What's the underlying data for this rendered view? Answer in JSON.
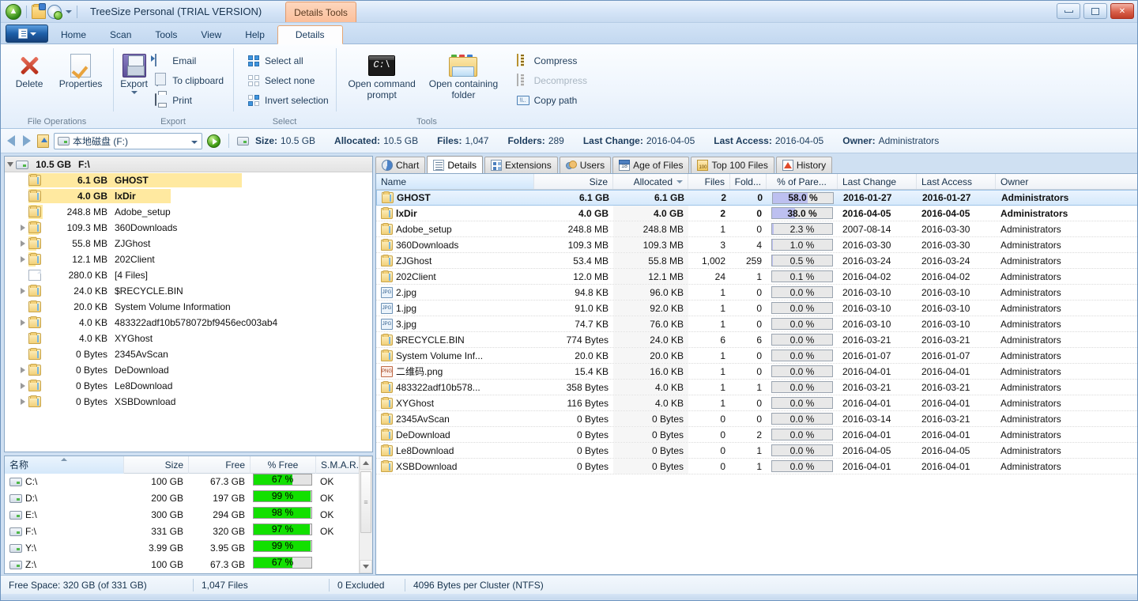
{
  "window": {
    "app_title": "TreeSize Personal  (TRIAL VERSION)",
    "context_tab_label": "Details Tools",
    "minimize": "Minimize",
    "maximize": "Maximize",
    "close": "Close"
  },
  "ribbon": {
    "tabs": [
      {
        "label": "Home",
        "active": false
      },
      {
        "label": "Scan",
        "active": false
      },
      {
        "label": "Tools",
        "active": false
      },
      {
        "label": "View",
        "active": false
      },
      {
        "label": "Help",
        "active": false
      },
      {
        "label": "Details",
        "active": true
      }
    ],
    "groups": [
      {
        "title": "File Operations",
        "big": [
          {
            "label": "Delete",
            "icon": "delete-icon"
          },
          {
            "label": "Properties",
            "icon": "properties-icon"
          }
        ],
        "small": []
      },
      {
        "title": "Export",
        "big": [
          {
            "label": "Export",
            "icon": "export-save-icon",
            "has_caret": true
          }
        ],
        "small": [
          {
            "label": "Email",
            "icon": "email-icon",
            "disabled": false
          },
          {
            "label": "To clipboard",
            "icon": "clipboard-icon",
            "disabled": false
          },
          {
            "label": "Print",
            "icon": "printer-icon",
            "disabled": false
          }
        ]
      },
      {
        "title": "Select",
        "big": [],
        "small": [
          {
            "label": "Select all",
            "icon": "select-all-icon",
            "disabled": false
          },
          {
            "label": "Select none",
            "icon": "select-none-icon",
            "disabled": false
          },
          {
            "label": "Invert selection",
            "icon": "invert-selection-icon",
            "disabled": false
          }
        ]
      },
      {
        "title": "Tools",
        "big": [
          {
            "label": "Open command prompt",
            "icon": "command-prompt-icon"
          },
          {
            "label": "Open containing folder",
            "icon": "folder-open-icon"
          }
        ],
        "small": [
          {
            "label": "Compress",
            "icon": "compress-icon",
            "disabled": false
          },
          {
            "label": "Decompress",
            "icon": "decompress-icon",
            "disabled": true
          },
          {
            "label": "Copy path",
            "icon": "copy-path-icon",
            "disabled": false
          }
        ]
      }
    ]
  },
  "address_bar": {
    "path_value": "本地磁盘 (F:)",
    "back": "Back",
    "forward": "Forward",
    "up": "Up one level",
    "go": "Go",
    "info": [
      {
        "label": "Size:",
        "value": "10.5 GB"
      },
      {
        "label": "Allocated:",
        "value": "10.5 GB"
      },
      {
        "label": "Files:",
        "value": "1,047"
      },
      {
        "label": "Folders:",
        "value": "289"
      },
      {
        "label": "Last Change:",
        "value": "2016-04-05"
      },
      {
        "label": "Last Access:",
        "value": "2016-04-05"
      },
      {
        "label": "Owner:",
        "value": "Administrators"
      }
    ]
  },
  "tree": {
    "root": {
      "size": "10.5 GB",
      "name": "F:\\",
      "icon": "drive-icon",
      "expanded": true
    },
    "rows": [
      {
        "size": "6.1 GB",
        "name": "GHOST",
        "icon": "folder-icon",
        "expandable": false,
        "bar_pct": 100,
        "highlight": true
      },
      {
        "size": "4.0 GB",
        "name": "lxDir",
        "icon": "folder-icon",
        "expandable": false,
        "bar_pct": 65.6,
        "highlight": true
      },
      {
        "size": "248.8 MB",
        "name": "Adobe_setup",
        "icon": "folder-icon",
        "expandable": false,
        "bar_pct": 4.0,
        "highlight": false
      },
      {
        "size": "109.3 MB",
        "name": "360Downloads",
        "icon": "folder-icon",
        "expandable": true,
        "bar_pct": 1.8,
        "highlight": false
      },
      {
        "size": "55.8 MB",
        "name": "ZJGhost",
        "icon": "folder-icon",
        "expandable": true,
        "bar_pct": 0.9,
        "highlight": false
      },
      {
        "size": "12.1 MB",
        "name": "202Client",
        "icon": "folder-icon",
        "expandable": true,
        "bar_pct": 0.2,
        "highlight": false
      },
      {
        "size": "280.0 KB",
        "name": "[4 Files]",
        "icon": "file-icon",
        "expandable": false,
        "bar_pct": 0,
        "highlight": false
      },
      {
        "size": "24.0 KB",
        "name": "$RECYCLE.BIN",
        "icon": "folder-icon",
        "expandable": true,
        "bar_pct": 0,
        "highlight": false
      },
      {
        "size": "20.0 KB",
        "name": "System Volume Information",
        "icon": "folder-icon",
        "expandable": false,
        "bar_pct": 0,
        "highlight": false
      },
      {
        "size": "4.0 KB",
        "name": "483322adf10b578072bf9456ec003ab4",
        "icon": "folder-icon",
        "expandable": true,
        "bar_pct": 0,
        "highlight": false
      },
      {
        "size": "4.0 KB",
        "name": "XYGhost",
        "icon": "folder-icon",
        "expandable": false,
        "bar_pct": 0,
        "highlight": false
      },
      {
        "size": "0 Bytes",
        "name": "2345AvScan",
        "icon": "folder-icon",
        "expandable": false,
        "bar_pct": 0,
        "highlight": false
      },
      {
        "size": "0 Bytes",
        "name": "DeDownload",
        "icon": "folder-icon",
        "expandable": true,
        "bar_pct": 0,
        "highlight": false
      },
      {
        "size": "0 Bytes",
        "name": "Le8Download",
        "icon": "folder-icon",
        "expandable": true,
        "bar_pct": 0,
        "highlight": false
      },
      {
        "size": "0 Bytes",
        "name": "XSBDownload",
        "icon": "folder-icon",
        "expandable": true,
        "bar_pct": 0,
        "highlight": false
      }
    ]
  },
  "drives_panel": {
    "columns": [
      "名称",
      "Size",
      "Free",
      "% Free",
      "S.M.A.R.T."
    ],
    "sorted_column": "名称",
    "rows": [
      {
        "name": "C:\\",
        "size": "100 GB",
        "free": "67.3 GB",
        "pct_free": "67 %",
        "pct": 67,
        "smart": "OK",
        "icon": "system-drive-icon"
      },
      {
        "name": "D:\\",
        "size": "200 GB",
        "free": "197 GB",
        "pct_free": "99 %",
        "pct": 99,
        "smart": "OK",
        "icon": "drive-icon"
      },
      {
        "name": "E:\\",
        "size": "300 GB",
        "free": "294 GB",
        "pct_free": "98 %",
        "pct": 98,
        "smart": "OK",
        "icon": "drive-icon"
      },
      {
        "name": "F:\\",
        "size": "331 GB",
        "free": "320 GB",
        "pct_free": "97 %",
        "pct": 97,
        "smart": "OK",
        "icon": "drive-icon"
      },
      {
        "name": "Y:\\",
        "size": "3.99 GB",
        "free": "3.95 GB",
        "pct_free": "99 %",
        "pct": 99,
        "smart": "",
        "icon": "drive-icon"
      },
      {
        "name": "Z:\\",
        "size": "100 GB",
        "free": "67.3 GB",
        "pct_free": "67 %",
        "pct": 67,
        "smart": "",
        "icon": "drive-icon"
      }
    ]
  },
  "view_tabs": [
    {
      "label": "Chart",
      "icon": "pie-chart-icon",
      "active": false
    },
    {
      "label": "Details",
      "icon": "details-list-icon",
      "active": true
    },
    {
      "label": "Extensions",
      "icon": "extensions-icon",
      "active": false
    },
    {
      "label": "Users",
      "icon": "users-icon",
      "active": false
    },
    {
      "label": "Age of Files",
      "icon": "calendar-icon",
      "active": false
    },
    {
      "label": "Top 100 Files",
      "icon": "top100-icon",
      "active": false
    },
    {
      "label": "History",
      "icon": "history-chart-icon",
      "active": false
    }
  ],
  "details_grid": {
    "columns": [
      {
        "key": "name",
        "label": "Name",
        "align": "left",
        "selected": true,
        "sorted": false
      },
      {
        "key": "size",
        "label": "Size",
        "align": "right",
        "selected": false,
        "sorted": false
      },
      {
        "key": "allocated",
        "label": "Allocated",
        "align": "right",
        "selected": false,
        "sorted": true
      },
      {
        "key": "files",
        "label": "Files",
        "align": "right",
        "selected": false,
        "sorted": false
      },
      {
        "key": "folders",
        "label": "Fold...",
        "align": "right",
        "selected": false,
        "sorted": false
      },
      {
        "key": "pct_parent",
        "label": "% of Pare...",
        "align": "center",
        "selected": false,
        "sorted": false
      },
      {
        "key": "last_change",
        "label": "Last Change",
        "align": "left",
        "selected": false,
        "sorted": false
      },
      {
        "key": "last_access",
        "label": "Last Access",
        "align": "left",
        "selected": false,
        "sorted": false
      },
      {
        "key": "owner",
        "label": "Owner",
        "align": "left",
        "selected": false,
        "sorted": false
      }
    ],
    "rows": [
      {
        "icon": "folder-icon",
        "name": "GHOST",
        "size": "6.1 GB",
        "allocated": "6.1 GB",
        "files": "2",
        "folders": "0",
        "pct_parent": "58.0 %",
        "pct": 58.0,
        "last_change": "2016-01-27",
        "last_access": "2016-01-27",
        "owner": "Administrators",
        "selected": true,
        "bold": true
      },
      {
        "icon": "folder-icon",
        "name": "lxDir",
        "size": "4.0 GB",
        "allocated": "4.0 GB",
        "files": "2",
        "folders": "0",
        "pct_parent": "38.0 %",
        "pct": 38.0,
        "last_change": "2016-04-05",
        "last_access": "2016-04-05",
        "owner": "Administrators",
        "selected": false,
        "bold": true
      },
      {
        "icon": "folder-icon",
        "name": "Adobe_setup",
        "size": "248.8 MB",
        "allocated": "248.8 MB",
        "files": "1",
        "folders": "0",
        "pct_parent": "2.3 %",
        "pct": 2.3,
        "last_change": "2007-08-14",
        "last_access": "2016-03-30",
        "owner": "Administrators",
        "selected": false,
        "bold": false
      },
      {
        "icon": "folder-icon",
        "name": "360Downloads",
        "size": "109.3 MB",
        "allocated": "109.3 MB",
        "files": "3",
        "folders": "4",
        "pct_parent": "1.0 %",
        "pct": 1.0,
        "last_change": "2016-03-30",
        "last_access": "2016-03-30",
        "owner": "Administrators",
        "selected": false,
        "bold": false
      },
      {
        "icon": "folder-icon",
        "name": "ZJGhost",
        "size": "53.4 MB",
        "allocated": "55.8 MB",
        "files": "1,002",
        "folders": "259",
        "pct_parent": "0.5 %",
        "pct": 0.5,
        "last_change": "2016-03-24",
        "last_access": "2016-03-24",
        "owner": "Administrators",
        "selected": false,
        "bold": false
      },
      {
        "icon": "folder-icon",
        "name": "202Client",
        "size": "12.0 MB",
        "allocated": "12.1 MB",
        "files": "24",
        "folders": "1",
        "pct_parent": "0.1 %",
        "pct": 0.1,
        "last_change": "2016-04-02",
        "last_access": "2016-04-02",
        "owner": "Administrators",
        "selected": false,
        "bold": false
      },
      {
        "icon": "jpg-icon",
        "name": "2.jpg",
        "size": "94.8 KB",
        "allocated": "96.0 KB",
        "files": "1",
        "folders": "0",
        "pct_parent": "0.0 %",
        "pct": 0,
        "last_change": "2016-03-10",
        "last_access": "2016-03-10",
        "owner": "Administrators",
        "selected": false,
        "bold": false
      },
      {
        "icon": "jpg-icon",
        "name": "1.jpg",
        "size": "91.0 KB",
        "allocated": "92.0 KB",
        "files": "1",
        "folders": "0",
        "pct_parent": "0.0 %",
        "pct": 0,
        "last_change": "2016-03-10",
        "last_access": "2016-03-10",
        "owner": "Administrators",
        "selected": false,
        "bold": false
      },
      {
        "icon": "jpg-icon",
        "name": "3.jpg",
        "size": "74.7 KB",
        "allocated": "76.0 KB",
        "files": "1",
        "folders": "0",
        "pct_parent": "0.0 %",
        "pct": 0,
        "last_change": "2016-03-10",
        "last_access": "2016-03-10",
        "owner": "Administrators",
        "selected": false,
        "bold": false
      },
      {
        "icon": "folder-icon",
        "name": "$RECYCLE.BIN",
        "size": "774 Bytes",
        "allocated": "24.0 KB",
        "files": "6",
        "folders": "6",
        "pct_parent": "0.0 %",
        "pct": 0,
        "last_change": "2016-03-21",
        "last_access": "2016-03-21",
        "owner": "Administrators",
        "selected": false,
        "bold": false
      },
      {
        "icon": "folder-icon",
        "name": "System Volume Inf...",
        "size": "20.0 KB",
        "allocated": "20.0 KB",
        "files": "1",
        "folders": "0",
        "pct_parent": "0.0 %",
        "pct": 0,
        "last_change": "2016-01-07",
        "last_access": "2016-01-07",
        "owner": "Administrators",
        "selected": false,
        "bold": false
      },
      {
        "icon": "png-icon",
        "name": "二维码.png",
        "size": "15.4 KB",
        "allocated": "16.0 KB",
        "files": "1",
        "folders": "0",
        "pct_parent": "0.0 %",
        "pct": 0,
        "last_change": "2016-04-01",
        "last_access": "2016-04-01",
        "owner": "Administrators",
        "selected": false,
        "bold": false
      },
      {
        "icon": "folder-icon",
        "name": "483322adf10b578...",
        "size": "358 Bytes",
        "allocated": "4.0 KB",
        "files": "1",
        "folders": "1",
        "pct_parent": "0.0 %",
        "pct": 0,
        "last_change": "2016-03-21",
        "last_access": "2016-03-21",
        "owner": "Administrators",
        "selected": false,
        "bold": false
      },
      {
        "icon": "folder-icon",
        "name": "XYGhost",
        "size": "116 Bytes",
        "allocated": "4.0 KB",
        "files": "1",
        "folders": "0",
        "pct_parent": "0.0 %",
        "pct": 0,
        "last_change": "2016-04-01",
        "last_access": "2016-04-01",
        "owner": "Administrators",
        "selected": false,
        "bold": false
      },
      {
        "icon": "folder-icon",
        "name": "2345AvScan",
        "size": "0 Bytes",
        "allocated": "0 Bytes",
        "files": "0",
        "folders": "0",
        "pct_parent": "0.0 %",
        "pct": 0,
        "last_change": "2016-03-14",
        "last_access": "2016-03-21",
        "owner": "Administrators",
        "selected": false,
        "bold": false
      },
      {
        "icon": "folder-icon",
        "name": "DeDownload",
        "size": "0 Bytes",
        "allocated": "0 Bytes",
        "files": "0",
        "folders": "2",
        "pct_parent": "0.0 %",
        "pct": 0,
        "last_change": "2016-04-01",
        "last_access": "2016-04-01",
        "owner": "Administrators",
        "selected": false,
        "bold": false
      },
      {
        "icon": "folder-icon",
        "name": "Le8Download",
        "size": "0 Bytes",
        "allocated": "0 Bytes",
        "files": "0",
        "folders": "1",
        "pct_parent": "0.0 %",
        "pct": 0,
        "last_change": "2016-04-05",
        "last_access": "2016-04-05",
        "owner": "Administrators",
        "selected": false,
        "bold": false
      },
      {
        "icon": "folder-icon",
        "name": "XSBDownload",
        "size": "0 Bytes",
        "allocated": "0 Bytes",
        "files": "0",
        "folders": "1",
        "pct_parent": "0.0 %",
        "pct": 0,
        "last_change": "2016-04-01",
        "last_access": "2016-04-01",
        "owner": "Administrators",
        "selected": false,
        "bold": false
      }
    ]
  },
  "status_bar": [
    "Free Space: 320 GB  (of 331 GB)",
    "1,047  Files",
    "0 Excluded",
    "4096 Bytes per Cluster (NTFS)"
  ],
  "colors": {
    "accent": "#1e5fa8",
    "tree_bar": "#ffe9a0",
    "pct_bar": "#bdc0f0",
    "free_bar": "#12e000",
    "context_tab": "#fbbf9b"
  }
}
